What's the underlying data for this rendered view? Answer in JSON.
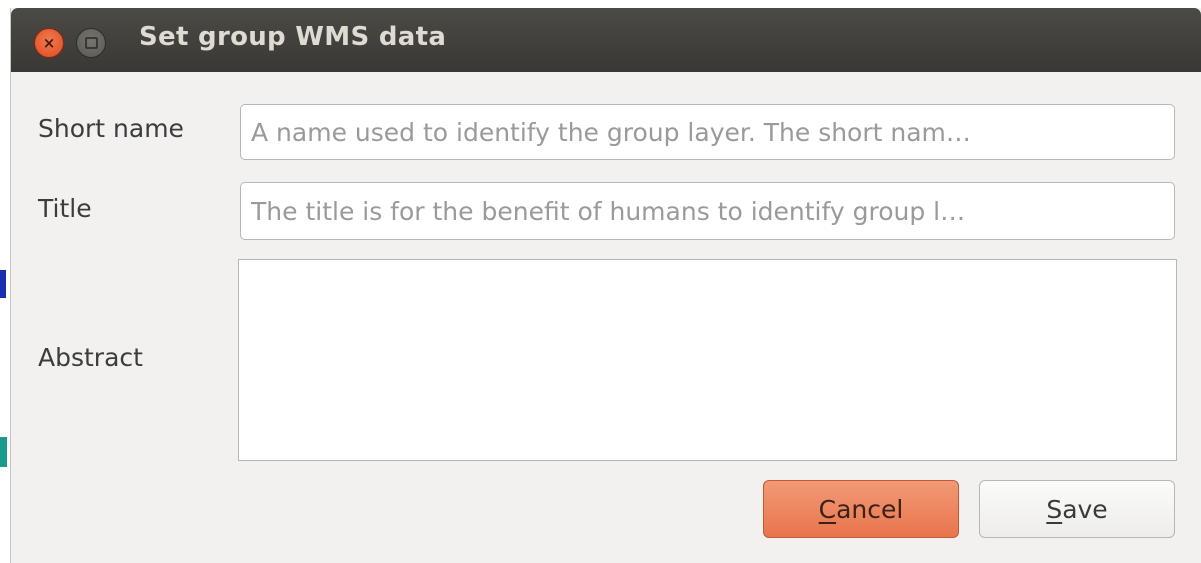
{
  "window": {
    "title": "Set group WMS data",
    "close_symbol": "×"
  },
  "form": {
    "short_name": {
      "label": "Short name",
      "value": "",
      "placeholder": "A name used to identify the group layer. The short nam…"
    },
    "title": {
      "label": "Title",
      "value": "",
      "placeholder": "The title is for the benefit of humans to identify group l…"
    },
    "abstract": {
      "label": "Abstract",
      "value": ""
    }
  },
  "buttons": {
    "cancel": {
      "mnemonic": "C",
      "rest": "ancel"
    },
    "save": {
      "mnemonic": "S",
      "rest": "ave"
    }
  },
  "colors": {
    "titlebar": "#3c3b37",
    "close_button": "#e95420",
    "default_button": "#ec8256",
    "dialog_background": "#f2f1f0"
  }
}
